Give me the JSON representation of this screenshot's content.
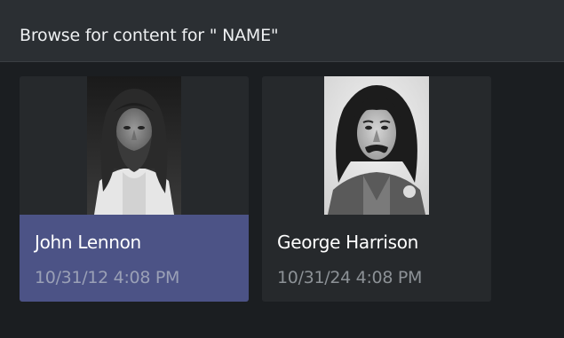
{
  "dialog": {
    "title": "Browse for content for \" NAME\""
  },
  "results": [
    {
      "name": "John Lennon",
      "date": "10/31/12 4:08 PM",
      "selected": true,
      "thumbnail": "john-lennon-photo"
    },
    {
      "name": "George Harrison",
      "date": "10/31/24 4:08 PM",
      "selected": false,
      "thumbnail": "george-harrison-photo"
    }
  ],
  "colors": {
    "selection": "#4c5386",
    "header": "#2b2f33",
    "card": "#26292c",
    "background": "#1b1e21"
  }
}
